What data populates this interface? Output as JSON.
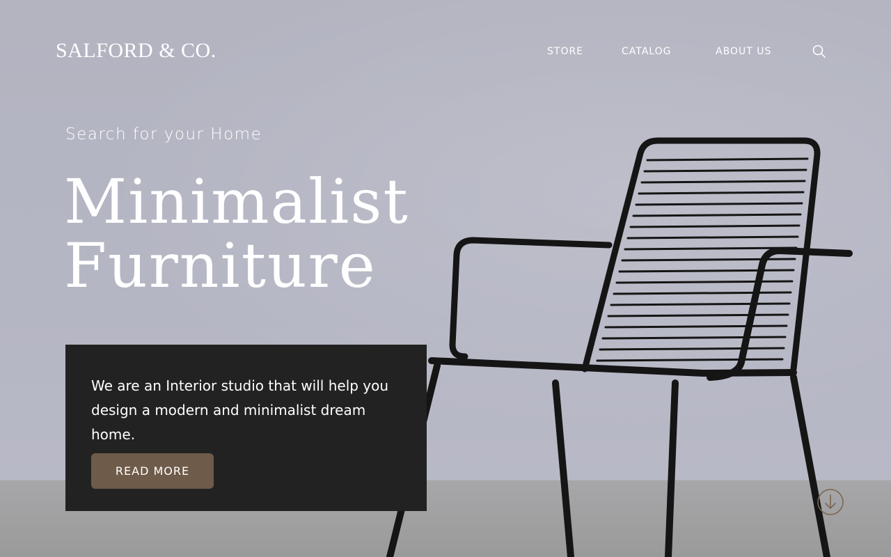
{
  "brand": {
    "logo_text": "SALFORD & CO."
  },
  "nav": {
    "items": [
      {
        "label": "STORE"
      },
      {
        "label": "CATALOG"
      },
      {
        "label": "ABOUT US"
      }
    ],
    "search_icon": "search-icon"
  },
  "hero": {
    "tagline": "Search for your Home",
    "headline_line1": "Minimalist",
    "headline_line2": "Furniture",
    "description": "We are an Interior studio that will help you design a modern and minimalist dream home.",
    "cta_label": "READ MORE",
    "scroll_icon": "arrow-down-circle-icon"
  },
  "colors": {
    "background": "#b4b5c2",
    "panel": "#222222",
    "cta": "#6f5b4a",
    "text": "#ffffff"
  }
}
